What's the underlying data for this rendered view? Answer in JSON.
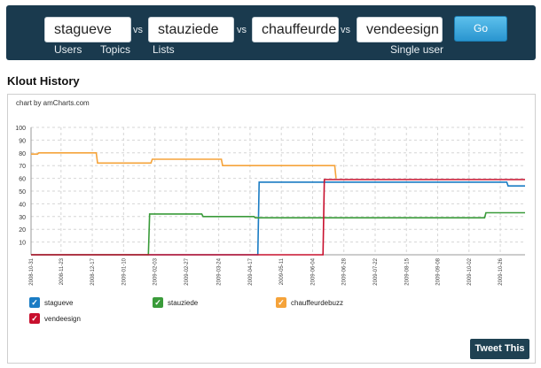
{
  "compare": {
    "users": [
      "stagueve",
      "stauziede",
      "chauffeurde",
      "vendeesign"
    ],
    "vs_label": "vs",
    "sub_labels": {
      "users": "Users",
      "topics": "Topics",
      "lists": "Lists",
      "single": "Single user"
    },
    "go_label": "Go"
  },
  "section_title": "Klout History",
  "credit": "chart by amCharts.com",
  "tweet_label": "Tweet This",
  "chart_data": {
    "type": "line",
    "title": "",
    "xlabel": "",
    "ylabel": "",
    "ylim": [
      0,
      100
    ],
    "y_ticks": [
      10,
      20,
      30,
      40,
      50,
      60,
      70,
      80,
      90,
      100
    ],
    "x_ticks": [
      "2008-10-31",
      "2008-11-23",
      "2008-12-17",
      "2009-01-10",
      "2009-02-03",
      "2009-02-27",
      "2009-03-24",
      "2009-04-17",
      "2009-05-11",
      "2009-06-04",
      "2009-06-28",
      "2009-07-22",
      "2009-08-15",
      "2009-09-08",
      "2009-10-02",
      "2009-10-26"
    ],
    "x_range": [
      "2008-10-31",
      "2009-11-14"
    ],
    "grid": true,
    "legend_position": "bottom",
    "series": [
      {
        "name": "stagueve",
        "color": "#1a7cc4",
        "points": [
          [
            "2008-10-31",
            0
          ],
          [
            "2009-04-23",
            0
          ],
          [
            "2009-04-24",
            57
          ],
          [
            "2009-10-31",
            57
          ],
          [
            "2009-11-01",
            54
          ],
          [
            "2009-11-14",
            54
          ]
        ]
      },
      {
        "name": "stauziede",
        "color": "#3a9b3a",
        "points": [
          [
            "2008-10-31",
            0
          ],
          [
            "2009-01-29",
            0
          ],
          [
            "2009-01-30",
            32
          ],
          [
            "2009-03-11",
            32
          ],
          [
            "2009-03-12",
            30
          ],
          [
            "2009-04-20",
            30
          ],
          [
            "2009-04-21",
            29
          ],
          [
            "2009-10-14",
            29
          ],
          [
            "2009-10-15",
            33
          ],
          [
            "2009-11-14",
            33
          ]
        ]
      },
      {
        "name": "chauffeurdebuzz",
        "color": "#f5a33a",
        "points": [
          [
            "2008-10-31",
            79
          ],
          [
            "2008-11-05",
            79
          ],
          [
            "2008-11-06",
            80
          ],
          [
            "2008-12-20",
            80
          ],
          [
            "2008-12-21",
            72
          ],
          [
            "2009-01-31",
            72
          ],
          [
            "2009-02-01",
            75
          ],
          [
            "2009-03-26",
            75
          ],
          [
            "2009-03-27",
            70
          ],
          [
            "2009-06-21",
            70
          ],
          [
            "2009-06-22",
            60
          ]
        ]
      },
      {
        "name": "vendeesign",
        "color": "#c8102e",
        "points": [
          [
            "2008-10-31",
            0
          ],
          [
            "2009-06-12",
            0
          ],
          [
            "2009-06-13",
            59
          ],
          [
            "2009-11-14",
            59
          ]
        ]
      }
    ]
  }
}
